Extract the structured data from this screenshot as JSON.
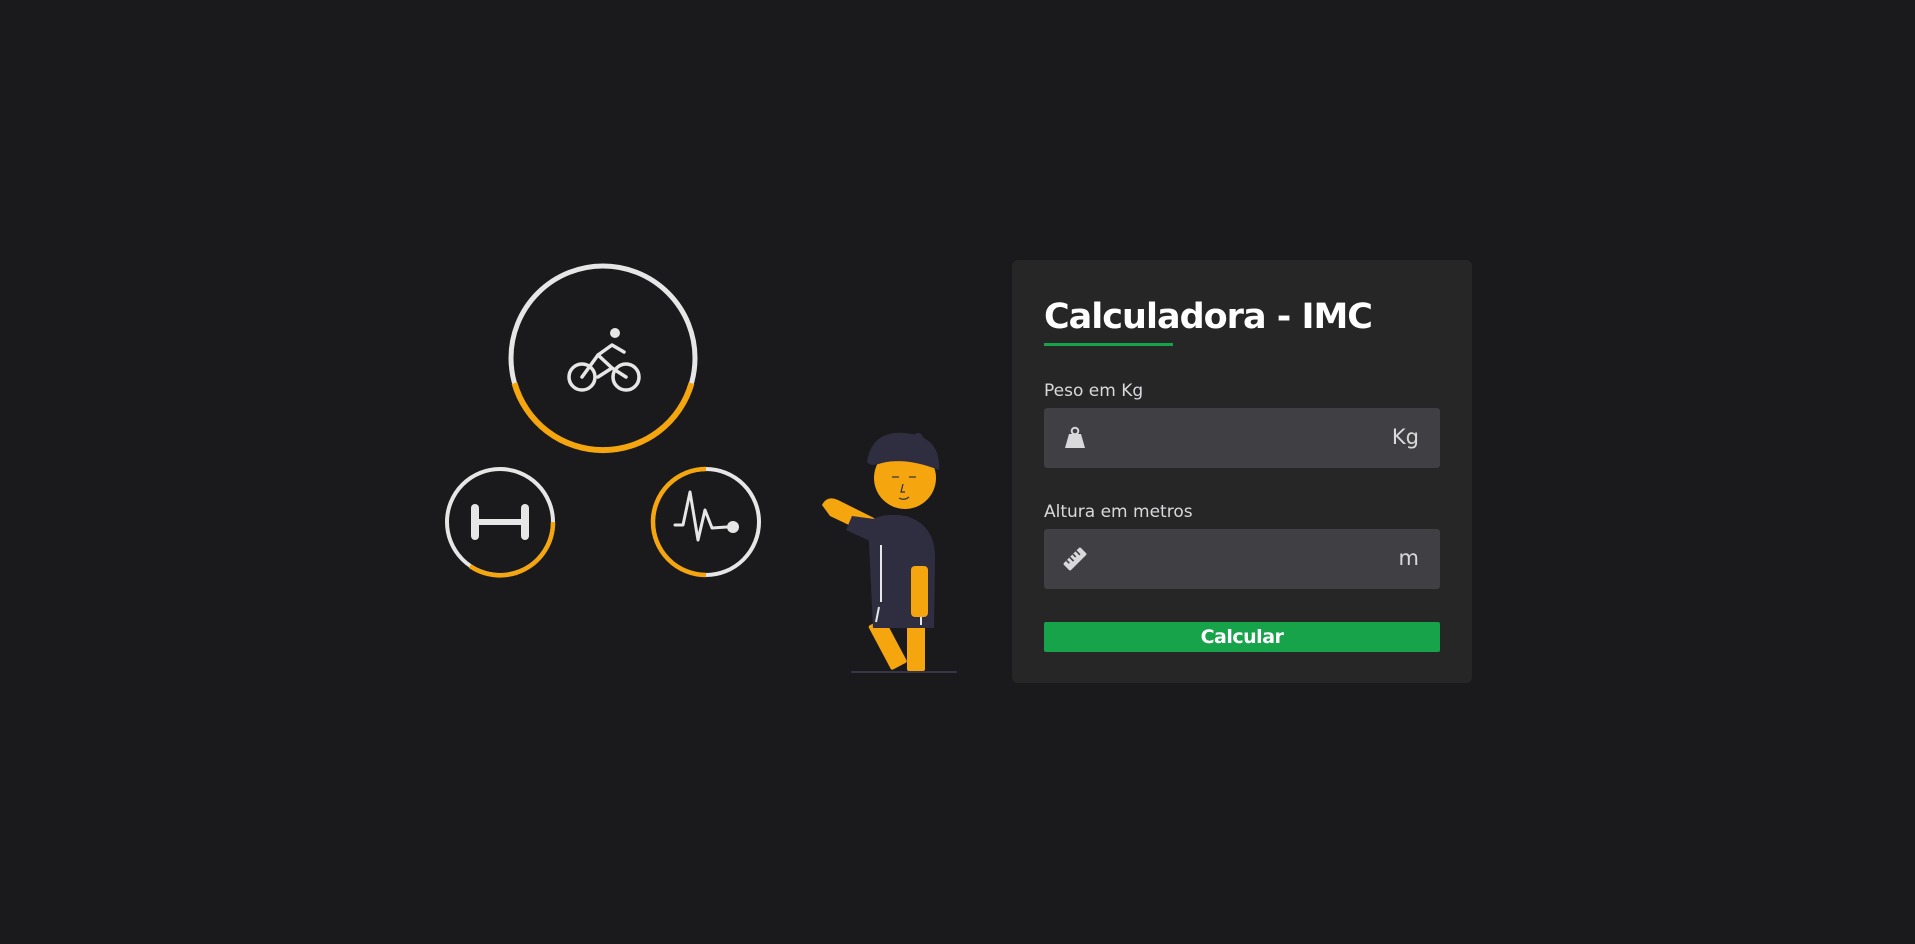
{
  "colors": {
    "background": "#1a1a1c",
    "card": "#262627",
    "input": "#404044",
    "accent_green": "#16a34a",
    "accent_orange": "#f5a60e",
    "ring_white": "#e6e6e6",
    "figure_dark": "#2f2e41"
  },
  "illustration": {
    "icons": [
      "bicycle-icon",
      "dumbbell-icon",
      "heartbeat-icon"
    ],
    "progress_rings": {
      "bicycle": 0.4,
      "dumbbell": 0.45,
      "heartbeat": 0.55
    }
  },
  "form": {
    "title": "Calculadora - IMC",
    "weight": {
      "label": "Peso em Kg",
      "value": "",
      "placeholder": "",
      "unit": "Kg",
      "icon": "weight-icon"
    },
    "height": {
      "label": "Altura em metros",
      "value": "",
      "placeholder": "",
      "unit": "m",
      "icon": "ruler-icon"
    },
    "submit_label": "Calcular"
  }
}
